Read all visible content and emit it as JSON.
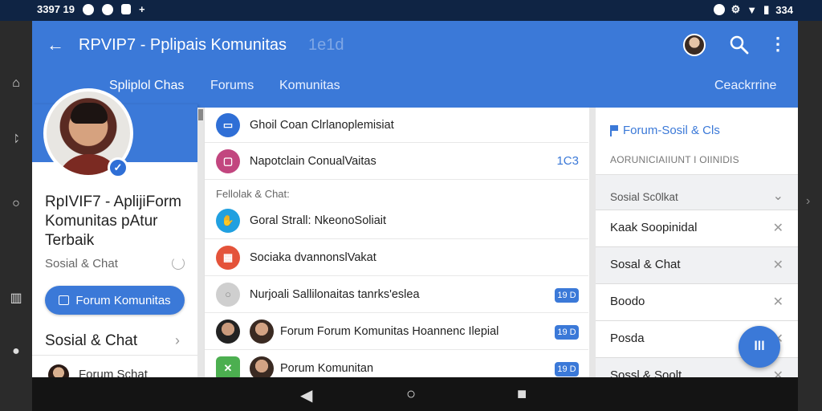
{
  "status_bar": {
    "left_text": "3397 19",
    "right_text": "334"
  },
  "app_bar": {
    "title": "RPVIP7 - Pplipais Komunitas",
    "title_ghost": "1e1d",
    "tabs": [
      {
        "label": "Spliplol Chas"
      },
      {
        "label": "Forums"
      },
      {
        "label": "Komunitas"
      },
      {
        "label": "Ceackrrine"
      }
    ]
  },
  "profile": {
    "name": "RpIVIF7 - AplijiForm Komunitas pAtur Terbaik",
    "subtitle": "Sosial & Chat",
    "forum_button_label": "Forum Komunitas",
    "section_title": "Sosial & Chat",
    "mini_item_label": "Forum Schat"
  },
  "middle_list": {
    "group_label": "Fellolak & Chat:",
    "rows": [
      {
        "text": "Ghoil Coan Clrlanoplemisiat",
        "icon": "tv-icon",
        "color": "#2f6fd6"
      },
      {
        "text": "Napotclain ConualVaitas",
        "count": "1C3",
        "icon": "chat-icon",
        "color": "#c2467f"
      },
      {
        "text": "Goral Strall: NkeonoSoliait",
        "icon": "hand-icon",
        "color": "#21a0e0"
      },
      {
        "text": "Sociaka dvannonslVakat",
        "icon": "grid-icon",
        "color": "#e4533a"
      },
      {
        "text": "Nurjoali Sallilonaitas tanrks'eslea",
        "badge": "19 D",
        "icon": "circle-icon",
        "color": "#cfcfcf"
      },
      {
        "text": "Forum Forum Komunitas Hoannenc Ilepial",
        "badge": "19 D",
        "icon": "avatar-icon",
        "color": "#3a2a22"
      },
      {
        "text": "Porum Komunitan",
        "badge": "19 D",
        "icon": "check-icon",
        "color": "#4caf50"
      }
    ]
  },
  "right_panel": {
    "header_title": "Forum-Sosil & Cls",
    "header_sub": "AORUNICIAIIUNT I OIINIDIS",
    "group_label": "Sosial Sc0lkat",
    "rows": [
      {
        "label": "Kaak Soopinidal"
      },
      {
        "label": "Sosal & Chat"
      },
      {
        "label": "Boodo"
      },
      {
        "label": "Posda"
      },
      {
        "label": "Sossl & Soolt"
      }
    ]
  },
  "fab": {
    "label": "lll"
  },
  "colors": {
    "accent": "#3b79d8",
    "status_bar": "#0f2444"
  }
}
